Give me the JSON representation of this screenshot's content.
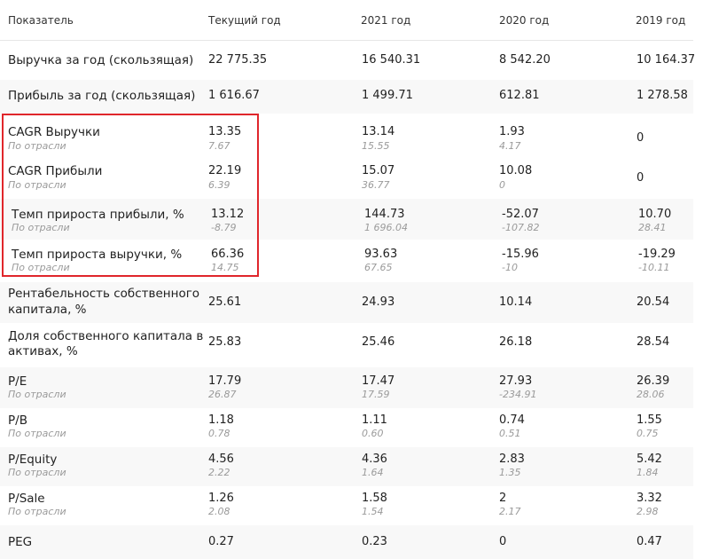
{
  "header": {
    "indicator": "Показатель",
    "current": "Текущий год",
    "y2021": "2021 год",
    "y2020": "2020 год",
    "y2019": "2019 год"
  },
  "rows": [
    {
      "label": "Выручка за год (скользящая)",
      "cur": "22 775.35",
      "y2021": "16 540.31",
      "y2020": "8 542.20",
      "y2019": "10 164.37"
    },
    {
      "label": "Прибыль за год (скользящая)",
      "cur": "1 616.67",
      "y2021": "1 499.71",
      "y2020": "612.81",
      "y2019": "1 278.58"
    },
    {
      "label": "CAGR Выручки",
      "sub": "По отрасли",
      "cur": "13.35",
      "cur_s": "7.67",
      "y2021": "13.14",
      "y2021_s": "15.55",
      "y2020": "1.93",
      "y2020_s": "4.17",
      "y2019": "0"
    },
    {
      "label": "CAGR Прибыли",
      "sub": "По отрасли",
      "cur": "22.19",
      "cur_s": "6.39",
      "y2021": "15.07",
      "y2021_s": "36.77",
      "y2020": "10.08",
      "y2020_s": "0",
      "y2019": "0"
    },
    {
      "label": "Темп прироста прибыли, %",
      "sub": "По отрасли",
      "cur": "13.12",
      "cur_s": "-8.79",
      "y2021": "144.73",
      "y2021_s": "1 696.04",
      "y2020": "-52.07",
      "y2020_s": "-107.82",
      "y2019": "10.70",
      "y2019_s": "28.41"
    },
    {
      "label": "Темп прироста выручки, %",
      "sub": "По отрасли",
      "cur": "66.36",
      "cur_s": "14.75",
      "y2021": "93.63",
      "y2021_s": "67.65",
      "y2020": "-15.96",
      "y2020_s": "-10",
      "y2019": "-19.29",
      "y2019_s": "-10.11"
    },
    {
      "label1": "Рентабельность собственного",
      "label2": "капитала, %",
      "cur": "25.61",
      "y2021": "24.93",
      "y2020": "10.14",
      "y2019": "20.54"
    },
    {
      "label1": "Доля собственного капитала в",
      "label2": "активах, %",
      "cur": "25.83",
      "y2021": "25.46",
      "y2020": "26.18",
      "y2019": "28.54"
    },
    {
      "label": "P/E",
      "sub": "По отрасли",
      "cur": "17.79",
      "cur_s": "26.87",
      "y2021": "17.47",
      "y2021_s": "17.59",
      "y2020": "27.93",
      "y2020_s": "-234.91",
      "y2019": "26.39",
      "y2019_s": "28.06"
    },
    {
      "label": "P/B",
      "sub": "По отрасли",
      "cur": "1.18",
      "cur_s": "0.78",
      "y2021": "1.11",
      "y2021_s": "0.60",
      "y2020": "0.74",
      "y2020_s": "0.51",
      "y2019": "1.55",
      "y2019_s": "0.75"
    },
    {
      "label": "P/Equity",
      "sub": "По отрасли",
      "cur": "4.56",
      "cur_s": "2.22",
      "y2021": "4.36",
      "y2021_s": "1.64",
      "y2020": "2.83",
      "y2020_s": "1.35",
      "y2019": "5.42",
      "y2019_s": "1.84"
    },
    {
      "label": "P/Sale",
      "sub": "По отрасли",
      "cur": "1.26",
      "cur_s": "2.08",
      "y2021": "1.58",
      "y2021_s": "1.54",
      "y2020": "2",
      "y2020_s": "2.17",
      "y2019": "3.32",
      "y2019_s": "2.98"
    },
    {
      "label": "PEG",
      "cur": "0.27",
      "y2021": "0.23",
      "y2020": "0",
      "y2019": "0.47"
    }
  ]
}
